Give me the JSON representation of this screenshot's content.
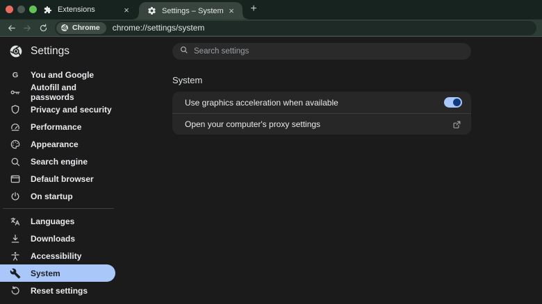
{
  "window": {
    "tabs": [
      {
        "label": "Extensions",
        "icon": "puzzle-icon",
        "active": false
      },
      {
        "label": "Settings – System",
        "icon": "gear-icon",
        "active": true
      }
    ],
    "close_glyph": "×",
    "new_tab_glyph": "+"
  },
  "toolbar": {
    "chip_label": "Chrome",
    "url": "chrome://settings/system"
  },
  "header": {
    "title": "Settings",
    "search_placeholder": "Search settings"
  },
  "sidebar": {
    "items": [
      {
        "label": "You and Google",
        "icon": "google-g-icon",
        "selected": false,
        "divider_after": false
      },
      {
        "label": "Autofill and passwords",
        "icon": "key-icon",
        "selected": false,
        "divider_after": false
      },
      {
        "label": "Privacy and security",
        "icon": "shield-icon",
        "selected": false,
        "divider_after": false
      },
      {
        "label": "Performance",
        "icon": "speedometer-icon",
        "selected": false,
        "divider_after": false
      },
      {
        "label": "Appearance",
        "icon": "palette-icon",
        "selected": false,
        "divider_after": false
      },
      {
        "label": "Search engine",
        "icon": "search-icon",
        "selected": false,
        "divider_after": false
      },
      {
        "label": "Default browser",
        "icon": "browser-window-icon",
        "selected": false,
        "divider_after": false
      },
      {
        "label": "On startup",
        "icon": "power-icon",
        "selected": false,
        "divider_after": true
      },
      {
        "label": "Languages",
        "icon": "translate-icon",
        "selected": false,
        "divider_after": false
      },
      {
        "label": "Downloads",
        "icon": "download-icon",
        "selected": false,
        "divider_after": false
      },
      {
        "label": "Accessibility",
        "icon": "accessibility-icon",
        "selected": false,
        "divider_after": false
      },
      {
        "label": "System",
        "icon": "wrench-icon",
        "selected": true,
        "divider_after": false
      },
      {
        "label": "Reset settings",
        "icon": "reset-icon",
        "selected": false,
        "divider_after": false
      }
    ]
  },
  "main": {
    "section_title": "System",
    "rows": [
      {
        "label": "Use graphics acceleration when available",
        "control": "toggle",
        "state": "on"
      },
      {
        "label": "Open your computer's proxy settings",
        "control": "external-link"
      }
    ]
  },
  "colors": {
    "toggle_track_on": "#a8c7fa",
    "toggle_thumb_on": "#0f3a7d",
    "selected_item_bg": "#aac7fa",
    "selected_item_text": "#1c2025"
  }
}
